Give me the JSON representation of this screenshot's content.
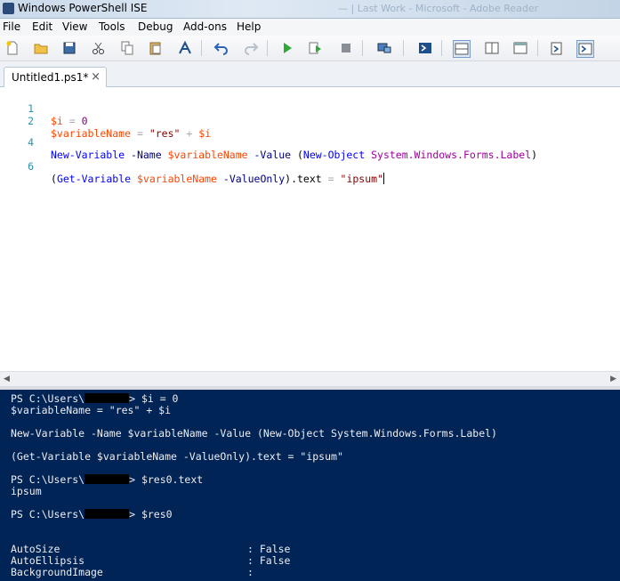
{
  "window": {
    "title": "Windows PowerShell ISE",
    "bg_title": "— | Last Work - Microsoft - Adobe Reader"
  },
  "menu": [
    "File",
    "Edit",
    "View",
    "Tools",
    "Debug",
    "Add-ons",
    "Help"
  ],
  "toolbar": {
    "icons": [
      "new-icon",
      "open-icon",
      "save-icon",
      "cut-icon",
      "copy-icon",
      "paste-icon",
      "clear-console-icon",
      "undo-icon",
      "redo-icon",
      "run-icon",
      "run-selection-icon",
      "stop-icon",
      "remote-icon",
      "powershell-icon",
      "layout-top-icon",
      "layout-right-icon",
      "layout-max-icon",
      "show-commands-icon",
      "show-addon-icon"
    ]
  },
  "tabs": [
    {
      "label": "Untitled1.ps1*",
      "close": "×"
    }
  ],
  "editor": {
    "line_numbers": [
      "1",
      "2",
      "4",
      "6"
    ],
    "lines": [
      [
        {
          "t": "$i",
          "c": "var"
        },
        {
          "t": " ",
          "c": "plain"
        },
        {
          "t": "=",
          "c": "op"
        },
        {
          "t": " ",
          "c": "plain"
        },
        {
          "t": "0",
          "c": "num"
        }
      ],
      [
        {
          "t": "$variableName",
          "c": "var"
        },
        {
          "t": " ",
          "c": "plain"
        },
        {
          "t": "=",
          "c": "op"
        },
        {
          "t": " ",
          "c": "plain"
        },
        {
          "t": "\"res\"",
          "c": "str"
        },
        {
          "t": " ",
          "c": "plain"
        },
        {
          "t": "+",
          "c": "op"
        },
        {
          "t": " ",
          "c": "plain"
        },
        {
          "t": "$i",
          "c": "var"
        }
      ],
      [
        {
          "t": "New-Variable",
          "c": "cmd"
        },
        {
          "t": " -Name ",
          "c": "par"
        },
        {
          "t": "$variableName",
          "c": "var"
        },
        {
          "t": " -Value ",
          "c": "par"
        },
        {
          "t": "(",
          "c": "plain"
        },
        {
          "t": "New-Object",
          "c": "cmd"
        },
        {
          "t": " ",
          "c": "plain"
        },
        {
          "t": "System.Windows.Forms.Label",
          "c": "typ"
        },
        {
          "t": ")",
          "c": "plain"
        }
      ],
      [
        {
          "t": "(",
          "c": "plain"
        },
        {
          "t": "Get-Variable",
          "c": "cmd"
        },
        {
          "t": " ",
          "c": "plain"
        },
        {
          "t": "$variableName",
          "c": "var"
        },
        {
          "t": " -ValueOnly",
          "c": "par"
        },
        {
          "t": ").text",
          "c": "plain"
        },
        {
          "t": " ",
          "c": "plain"
        },
        {
          "t": "=",
          "c": "op"
        },
        {
          "t": " ",
          "c": "plain"
        },
        {
          "t": "\"ipsum\"",
          "c": "str"
        }
      ]
    ]
  },
  "console": {
    "prompt_prefix": "PS C:\\Users\\",
    "lines": [
      {
        "kind": "prompt",
        "rest": "> $i = 0"
      },
      {
        "kind": "text",
        "text": "$variableName = \"res\" + $i"
      },
      {
        "kind": "text",
        "text": "New-Variable -Name $variableName -Value (New-Object System.Windows.Forms.Label)"
      },
      {
        "kind": "text",
        "text": "(Get-Variable $variableName -ValueOnly).text = \"ipsum\""
      },
      {
        "kind": "prompt",
        "rest": "> $res0.text"
      },
      {
        "kind": "text",
        "text": "ipsum"
      },
      {
        "kind": "prompt",
        "rest": "> $res0"
      },
      {
        "kind": "prop",
        "name": "AutoSize",
        "value": ": False"
      },
      {
        "kind": "prop",
        "name": "AutoEllipsis",
        "value": ": False"
      },
      {
        "kind": "prop",
        "name": "BackgroundImage",
        "value": ":"
      }
    ]
  }
}
